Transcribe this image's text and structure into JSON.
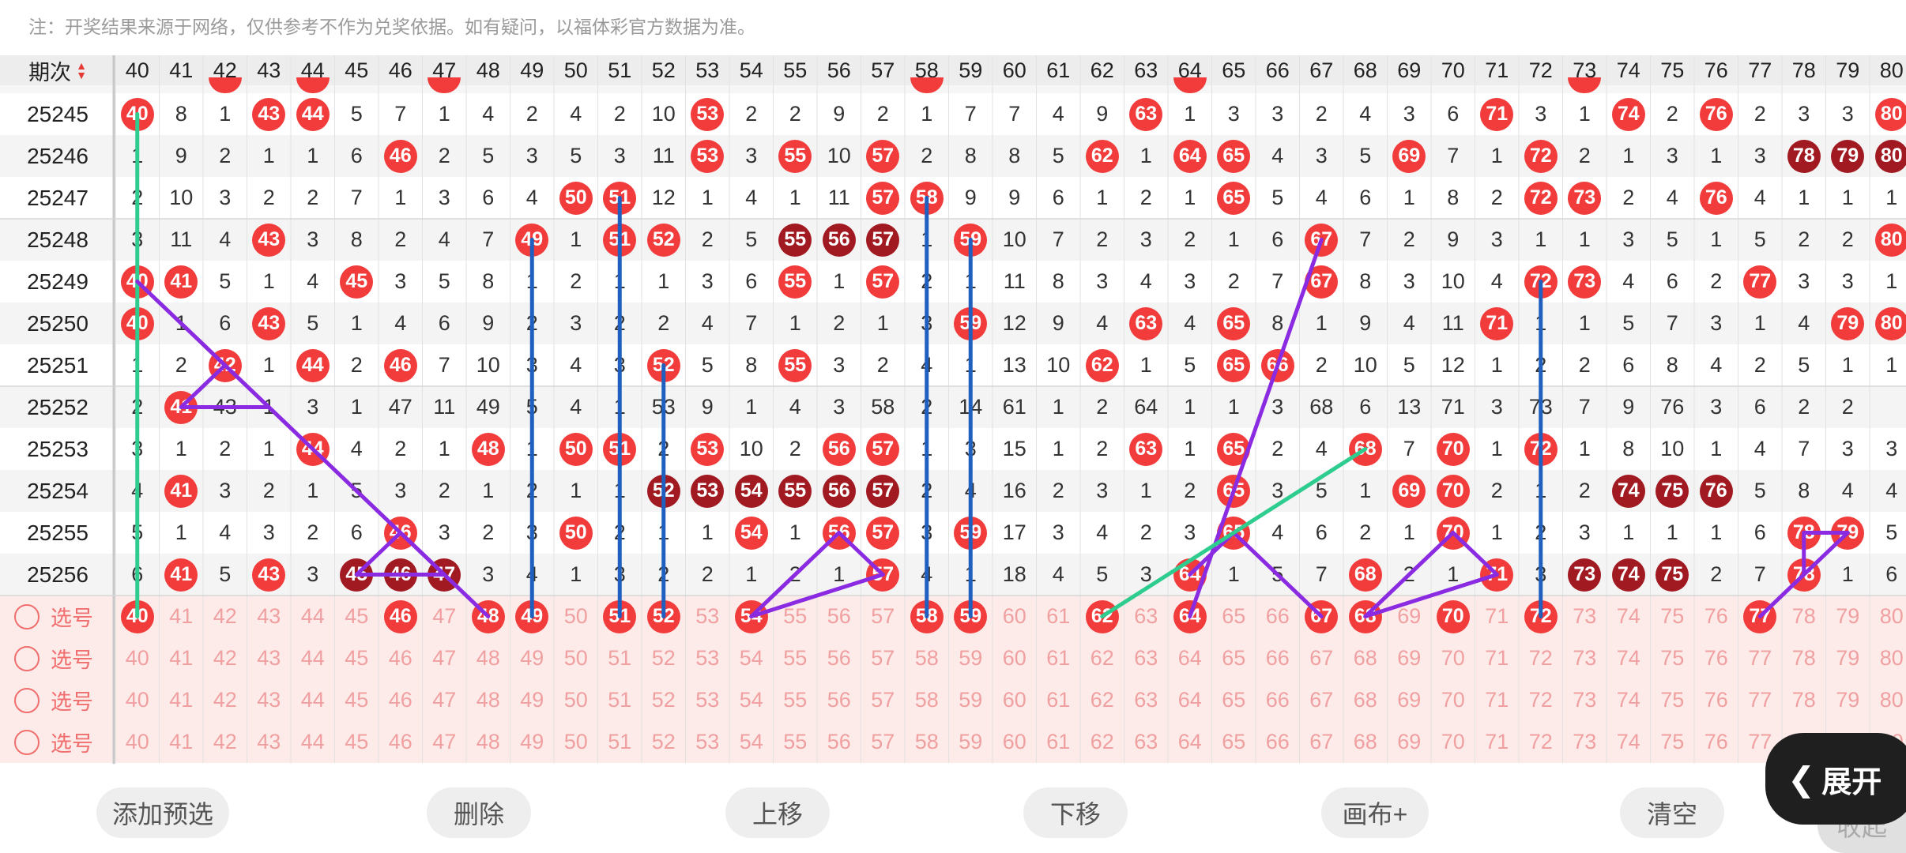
{
  "notice": "注：开奖结果来源于网络，仅供参考不作为兑奖依据。如有疑问，以福体彩官方数据为准。",
  "header_label": "期次",
  "numbers": [
    40,
    41,
    42,
    43,
    44,
    45,
    46,
    47,
    48,
    49,
    50,
    51,
    52,
    53,
    54,
    55,
    56,
    57,
    58,
    59,
    60,
    61,
    62,
    63,
    64,
    65,
    66,
    67,
    68,
    69,
    70,
    71,
    72,
    73,
    74,
    75,
    76,
    77,
    78,
    79,
    80
  ],
  "partial_top_row": [
    null,
    null,
    "42",
    null,
    "44",
    null,
    null,
    "47",
    null,
    null,
    null,
    null,
    null,
    null,
    null,
    null,
    null,
    null,
    "58",
    null,
    null,
    null,
    null,
    null,
    "64",
    null,
    null,
    null,
    null,
    null,
    null,
    null,
    null,
    "73",
    null,
    null,
    null,
    null,
    null,
    null,
    null
  ],
  "rows": [
    {
      "issue": "25245",
      "cells": [
        "40",
        "8",
        "1",
        "43",
        "44",
        "5",
        "7",
        "1",
        "4",
        "2",
        "4",
        "2",
        "10",
        "53",
        "2",
        "2",
        "9",
        "2",
        "1",
        "7",
        "7",
        "4",
        "9",
        "63",
        "1",
        "3",
        "3",
        "2",
        "4",
        "3",
        "6",
        "71",
        "3",
        "1",
        "74",
        "2",
        "76",
        "2",
        "3",
        "3",
        "80"
      ],
      "dark": []
    },
    {
      "issue": "25246",
      "cells": [
        "1",
        "9",
        "2",
        "1",
        "1",
        "6",
        "46",
        "2",
        "5",
        "3",
        "5",
        "3",
        "11",
        "53",
        "3",
        "55",
        "10",
        "57",
        "2",
        "8",
        "8",
        "5",
        "62",
        "1",
        "64",
        "65",
        "4",
        "3",
        "5",
        "69",
        "7",
        "1",
        "72",
        "2",
        "1",
        "3",
        "1",
        "3",
        "78",
        "79",
        "80"
      ],
      "dark": [
        "78",
        "79",
        "80"
      ]
    },
    {
      "issue": "25247",
      "cells": [
        "2",
        "10",
        "3",
        "2",
        "2",
        "7",
        "1",
        "3",
        "6",
        "4",
        "50",
        "51",
        "12",
        "1",
        "4",
        "1",
        "11",
        "57",
        "58",
        "9",
        "9",
        "6",
        "1",
        "2",
        "1",
        "65",
        "5",
        "4",
        "6",
        "1",
        "8",
        "2",
        "72",
        "73",
        "2",
        "4",
        "76",
        "4",
        "1",
        "1",
        "1"
      ],
      "dark": []
    },
    {
      "issue": "25248",
      "cells": [
        "3",
        "11",
        "4",
        "43",
        "3",
        "8",
        "2",
        "4",
        "7",
        "49",
        "1",
        "51",
        "52",
        "2",
        "5",
        "55",
        "56",
        "57",
        "1",
        "59",
        "10",
        "7",
        "2",
        "3",
        "2",
        "1",
        "6",
        "67",
        "7",
        "2",
        "9",
        "3",
        "1",
        "1",
        "3",
        "5",
        "1",
        "5",
        "2",
        "2",
        "80"
      ],
      "dark": [
        "55",
        "56",
        "57"
      ]
    },
    {
      "issue": "25249",
      "cells": [
        "40",
        "41",
        "5",
        "1",
        "4",
        "45",
        "3",
        "5",
        "8",
        "1",
        "2",
        "1",
        "1",
        "3",
        "6",
        "55",
        "1",
        "57",
        "2",
        "1",
        "11",
        "8",
        "3",
        "4",
        "3",
        "2",
        "7",
        "67",
        "8",
        "3",
        "10",
        "4",
        "72",
        "73",
        "4",
        "6",
        "2",
        "77",
        "3",
        "3",
        "1"
      ],
      "dark": []
    },
    {
      "issue": "25250",
      "cells": [
        "40",
        "1",
        "6",
        "43",
        "5",
        "1",
        "4",
        "6",
        "9",
        "2",
        "3",
        "2",
        "2",
        "4",
        "7",
        "1",
        "2",
        "1",
        "3",
        "59",
        "12",
        "9",
        "4",
        "63",
        "4",
        "65",
        "8",
        "1",
        "9",
        "4",
        "11",
        "71",
        "1",
        "1",
        "5",
        "7",
        "3",
        "1",
        "4",
        "79",
        "80"
      ],
      "dark": []
    },
    {
      "issue": "25251",
      "cells": [
        "1",
        "2",
        "42",
        "1",
        "44",
        "2",
        "46",
        "7",
        "10",
        "3",
        "4",
        "3",
        "52",
        "5",
        "8",
        "55",
        "3",
        "2",
        "4",
        "1",
        "13",
        "10",
        "62",
        "1",
        "5",
        "65",
        "66",
        "2",
        "10",
        "5",
        "12",
        "1",
        "2",
        "2",
        "6",
        "8",
        "4",
        "2",
        "5",
        "1",
        "1"
      ],
      "dark": []
    },
    {
      "issue": "25252",
      "cells": [
        "2",
        "41",
        "43",
        "1",
        "3",
        "1",
        "47",
        "11",
        "49",
        "5",
        "4",
        "1",
        "53",
        "9",
        "1",
        "4",
        "3",
        "58",
        "2",
        "14",
        "61",
        "1",
        "2",
        "64",
        "1",
        "1",
        "3",
        "68",
        "6",
        "13",
        "71",
        "3",
        "73",
        "7",
        "9",
        "76",
        "3",
        "6",
        "2",
        "2"
      ],
      "dark": [],
      "fix": true
    },
    {
      "issue": "25253",
      "cells": [
        "3",
        "1",
        "2",
        "1",
        "44",
        "4",
        "2",
        "1",
        "48",
        "1",
        "50",
        "51",
        "2",
        "53",
        "10",
        "2",
        "56",
        "57",
        "1",
        "3",
        "15",
        "1",
        "2",
        "63",
        "1",
        "65",
        "2",
        "4",
        "68",
        "7",
        "70",
        "1",
        "72",
        "1",
        "8",
        "10",
        "1",
        "4",
        "7",
        "3",
        "3"
      ],
      "dark": []
    },
    {
      "issue": "25254",
      "cells": [
        "4",
        "41",
        "3",
        "2",
        "1",
        "5",
        "3",
        "2",
        "1",
        "2",
        "1",
        "1",
        "52",
        "53",
        "54",
        "55",
        "56",
        "57",
        "2",
        "4",
        "16",
        "2",
        "3",
        "1",
        "2",
        "65",
        "3",
        "5",
        "1",
        "69",
        "70",
        "2",
        "1",
        "2",
        "74",
        "75",
        "76",
        "5",
        "8",
        "4",
        "4"
      ],
      "dark": [
        "52",
        "53",
        "54",
        "55",
        "56",
        "57",
        "74",
        "75",
        "76"
      ]
    },
    {
      "issue": "25255",
      "cells": [
        "5",
        "1",
        "4",
        "3",
        "2",
        "6",
        "46",
        "3",
        "2",
        "3",
        "50",
        "2",
        "1",
        "1",
        "54",
        "1",
        "56",
        "57",
        "3",
        "59",
        "17",
        "3",
        "4",
        "2",
        "3",
        "65",
        "4",
        "6",
        "2",
        "1",
        "70",
        "1",
        "2",
        "3",
        "1",
        "1",
        "1",
        "6",
        "78",
        "79",
        "5"
      ],
      "dark": []
    },
    {
      "issue": "25256",
      "cells": [
        "6",
        "41",
        "5",
        "43",
        "3",
        "45",
        "46",
        "47",
        "3",
        "4",
        "1",
        "3",
        "2",
        "2",
        "1",
        "2",
        "1",
        "57",
        "4",
        "1",
        "18",
        "4",
        "5",
        "3",
        "64",
        "1",
        "5",
        "7",
        "68",
        "2",
        "1",
        "71",
        "3",
        "73",
        "74",
        "75",
        "2",
        "7",
        "78",
        "1",
        "6"
      ],
      "dark": [
        "45",
        "46",
        "47",
        "73",
        "74",
        "75"
      ]
    }
  ],
  "pick_label": "选号",
  "pick_rows": [
    {
      "selected": [
        "40",
        "46",
        "48",
        "49",
        "51",
        "52",
        "54",
        "58",
        "59",
        "62",
        "64",
        "67",
        "68",
        "70",
        "72",
        "77"
      ]
    },
    {
      "selected": []
    },
    {
      "selected": []
    },
    {
      "selected": []
    }
  ],
  "toolbar": {
    "add_preselect": "添加预选",
    "delete": "删除",
    "move_up": "上移",
    "move_down": "下移",
    "canvas_plus": "画布+",
    "clear": "清空"
  },
  "expand_label": "展开",
  "collapse_label": "收起",
  "colors": {
    "ball_red": "#f23c3c",
    "ball_dark": "#a11a21",
    "line_purple": "#8a2be2",
    "line_blue": "#1f5fbf",
    "line_green": "#2ecc8f",
    "pick_bg": "#fdebea"
  }
}
